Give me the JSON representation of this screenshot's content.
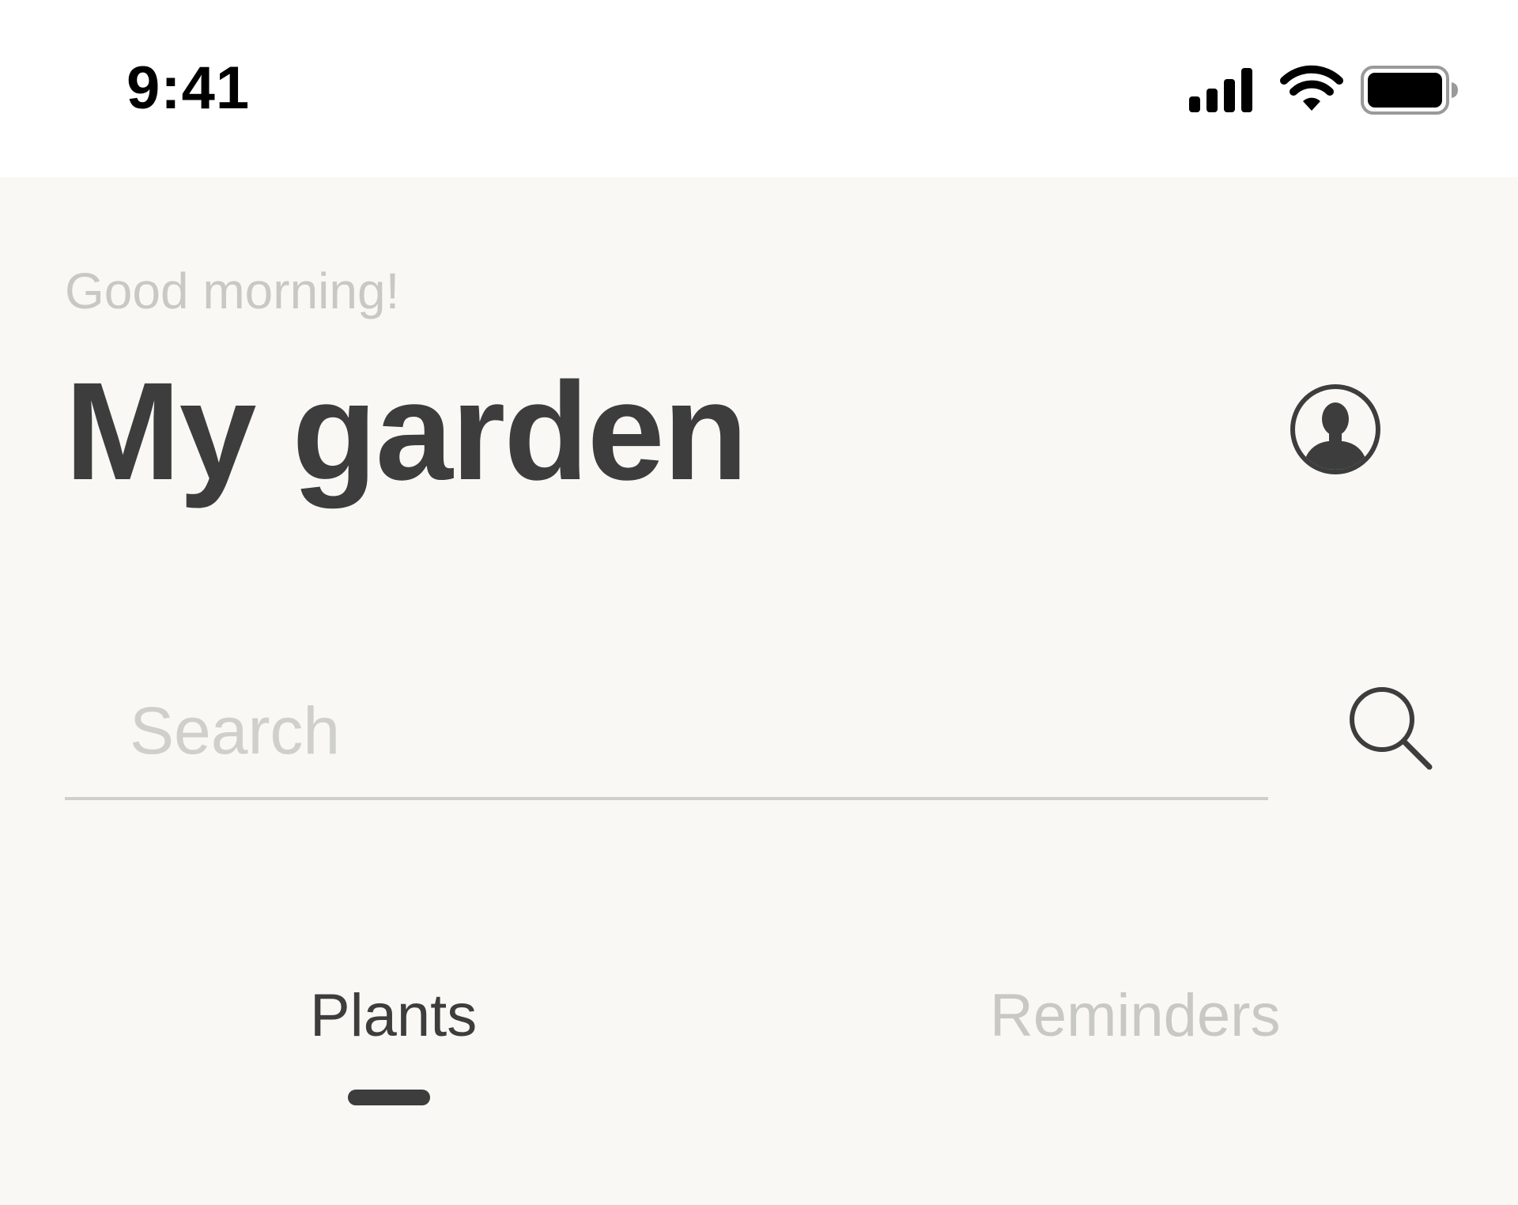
{
  "status_bar": {
    "time": "9:41",
    "icons": [
      "signal-icon",
      "wifi-icon",
      "battery-icon"
    ]
  },
  "header": {
    "greeting": "Good morning!",
    "title": "My garden",
    "profile_icon": "user-avatar-icon"
  },
  "search": {
    "value": "",
    "placeholder": "Search",
    "icon": "search-icon"
  },
  "tabs": [
    {
      "label": "Plants",
      "active": true
    },
    {
      "label": "Reminders",
      "active": false
    }
  ],
  "colors": {
    "background": "#f9f8f5",
    "text_primary": "#3d3d3d",
    "text_muted": "#c8c8c4",
    "divider": "#cfcfcb"
  }
}
